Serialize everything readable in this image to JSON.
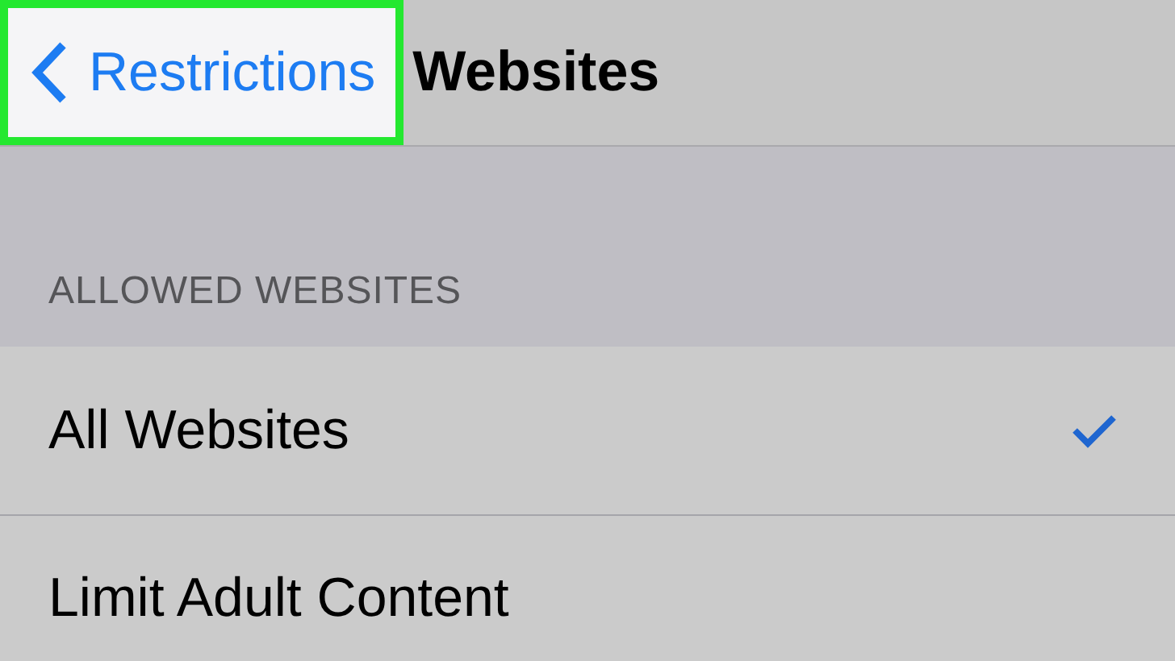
{
  "nav_bar": {
    "back_button": {
      "label": "Restrictions",
      "highlighted": true
    },
    "title": "Websites"
  },
  "section": {
    "header": "ALLOWED WEBSITES",
    "rows": [
      {
        "label": "All Websites",
        "selected": true
      },
      {
        "label": "Limit Adult Content",
        "selected": false
      }
    ]
  }
}
